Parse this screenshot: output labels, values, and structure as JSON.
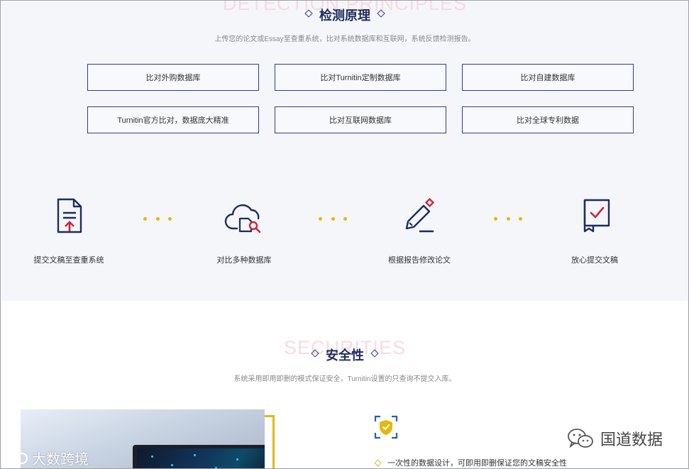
{
  "principles": {
    "ghost_text": "DETECTION PRINCIPLES",
    "title": "检测原理",
    "subtitle": "上传您的论文或Essay至查重系统，比对系统数据库和互联网，系统反馈检测报告。",
    "databases": [
      "比对外购数据库",
      "比对Turnitin定制数据库",
      "比对自建数据库",
      "Turnitin官方比对，数据庞大精准",
      "比对互联网数据库",
      "比对全球专利数据"
    ],
    "steps": [
      {
        "label": "提交文稿至查重系统",
        "icon": "document-upload-icon"
      },
      {
        "label": "对比多种数据库",
        "icon": "cloud-search-icon"
      },
      {
        "label": "根据报告修改论文",
        "icon": "pen-edit-icon"
      },
      {
        "label": "放心提交文稿",
        "icon": "book-check-icon"
      }
    ]
  },
  "security": {
    "ghost_text": "SECURITIES",
    "title": "安全性",
    "subtitle": "系统采用即用即删的模式保证安全，Turnitin设置的只查询不提交入库。",
    "feature": "一次性的数据设计，可即用即删保证您的文稿安全性",
    "icon": "shield-check-icon"
  },
  "watermarks": {
    "left": "大数跨境",
    "right": "国道数据"
  },
  "colors": {
    "navy": "#1f2b5e",
    "accent_red": "#d0243a",
    "accent_yellow": "#e5b70f",
    "section_bg": "#f4f6fa"
  }
}
